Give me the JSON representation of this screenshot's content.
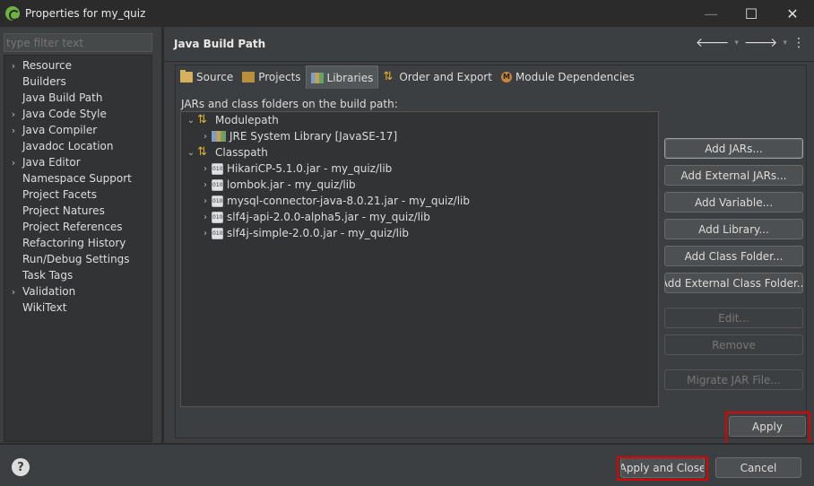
{
  "window": {
    "title": "Properties for my_quiz",
    "min": "—",
    "max": "☐",
    "close": "✕"
  },
  "filter": {
    "placeholder": "type filter text"
  },
  "nav": [
    {
      "label": "Resource",
      "expandable": true
    },
    {
      "label": "Builders",
      "expandable": false
    },
    {
      "label": "Java Build Path",
      "expandable": false
    },
    {
      "label": "Java Code Style",
      "expandable": true
    },
    {
      "label": "Java Compiler",
      "expandable": true
    },
    {
      "label": "Javadoc Location",
      "expandable": false
    },
    {
      "label": "Java Editor",
      "expandable": true
    },
    {
      "label": "Namespace Support",
      "expandable": false
    },
    {
      "label": "Project Facets",
      "expandable": false
    },
    {
      "label": "Project Natures",
      "expandable": false
    },
    {
      "label": "Project References",
      "expandable": false
    },
    {
      "label": "Refactoring History",
      "expandable": false
    },
    {
      "label": "Run/Debug Settings",
      "expandable": false
    },
    {
      "label": "Task Tags",
      "expandable": false
    },
    {
      "label": "Validation",
      "expandable": true
    },
    {
      "label": "WikiText",
      "expandable": false
    }
  ],
  "page": {
    "title": "Java Build Path",
    "back": "🡐",
    "forward": "🡒",
    "menu": "⋮",
    "dropdown": "▾"
  },
  "tabs": {
    "source": "Source",
    "projects": "Projects",
    "libraries": "Libraries",
    "order": "Order and Export",
    "module": "Module Dependencies"
  },
  "libraries": {
    "caption": "JARs and class folders on the build path:",
    "modulepath": {
      "label": "Modulepath",
      "children": [
        "JRE System Library [JavaSE-17]"
      ]
    },
    "classpath": {
      "label": "Classpath",
      "children": [
        "HikariCP-5.1.0.jar - my_quiz/lib",
        "lombok.jar - my_quiz/lib",
        "mysql-connector-java-8.0.21.jar - my_quiz/lib",
        "slf4j-api-2.0.0-alpha5.jar - my_quiz/lib",
        "slf4j-simple-2.0.0.jar - my_quiz/lib"
      ]
    },
    "jar_icon_text": "010"
  },
  "buttons": {
    "add_jars": "Add JARs...",
    "add_external_jars": "Add External JARs...",
    "add_variable": "Add Variable...",
    "add_library": "Add Library...",
    "add_class_folder": "Add Class Folder...",
    "add_external_class_folder": "Add External Class Folder...",
    "edit": "Edit...",
    "remove": "Remove",
    "migrate": "Migrate JAR File...",
    "apply": "Apply",
    "apply_close": "Apply and Close",
    "cancel": "Cancel"
  },
  "help": "?",
  "colors": {
    "highlight": "#e00000",
    "background": "#3c3f41",
    "tree_bg": "#313335"
  }
}
